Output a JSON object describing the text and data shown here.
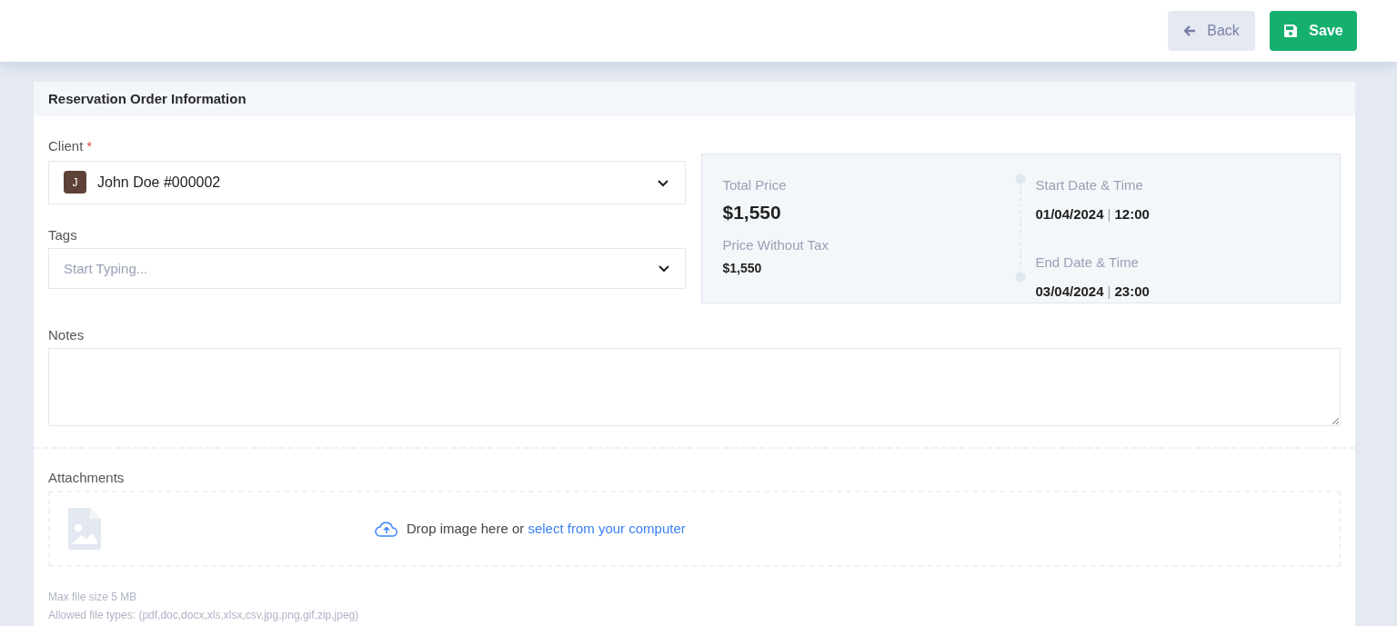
{
  "toolbar": {
    "back": "Back",
    "save": "Save"
  },
  "card": {
    "title": "Reservation Order Information",
    "client": {
      "label": "Client",
      "required_mark": "*",
      "avatar": "J",
      "value": "John Doe #000002"
    },
    "tags": {
      "label": "Tags",
      "placeholder": "Start Typing..."
    },
    "summary": {
      "total_label": "Total Price",
      "total": "$1,550",
      "net_label": "Price Without Tax",
      "net": "$1,550",
      "dates": [
        {
          "label": "Start Date & Time",
          "date": "01/04/2024",
          "separator": "|",
          "time": "12:00"
        },
        {
          "label": "End Date & Time",
          "date": "03/04/2024",
          "separator": "|",
          "time": "23:00"
        }
      ]
    },
    "notes": {
      "label": "Notes"
    },
    "attachments": {
      "label": "Attachments",
      "drop_text": "Drop image here or ",
      "link": "select from your computer",
      "max_size": "Max file size 5 MB",
      "allowed": "Allowed file types: (pdf,doc,docx,xls,xlsx,csv,jpg,png,gif,zip,jpeg)"
    }
  }
}
